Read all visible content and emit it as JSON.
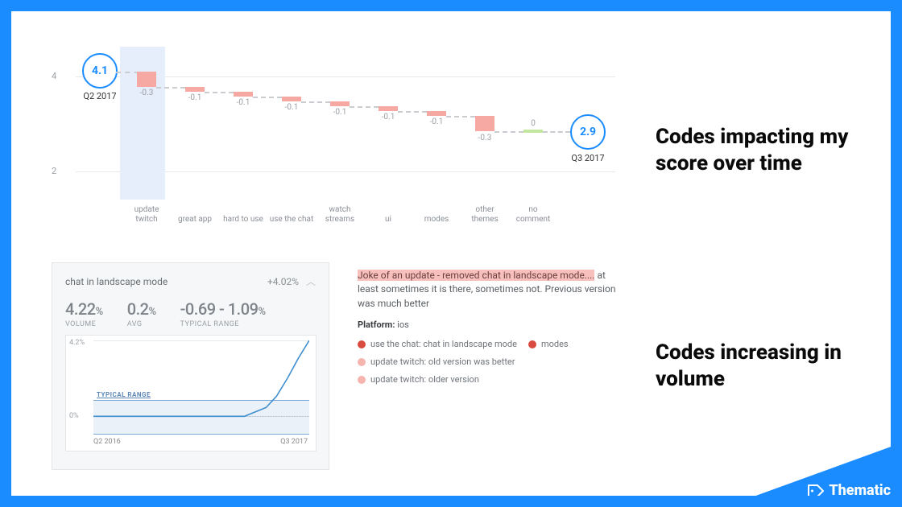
{
  "headings": {
    "top": "Codes impacting my score over time",
    "bottom": "Codes increasing in volume"
  },
  "chart_data": [
    {
      "type": "waterfall",
      "title": "",
      "xlabel": "",
      "ylabel": "",
      "ylim": [
        2,
        4.5
      ],
      "y_ticks": [
        2,
        4
      ],
      "start": {
        "label": "Q2 2017",
        "value": 4.1
      },
      "end": {
        "label": "Q3 2017",
        "value": 2.9
      },
      "categories": [
        "update twitch",
        "great app",
        "hard to use",
        "use the chat",
        "watch streams",
        "ui",
        "modes",
        "other themes",
        "no comment"
      ],
      "deltas": [
        -0.3,
        -0.1,
        -0.1,
        -0.1,
        -0.1,
        -0.1,
        -0.1,
        -0.3,
        0
      ],
      "delta_labels": [
        "-0.3",
        "-0.1",
        "-0.1",
        "-0.1",
        "-0.1",
        "-0.1",
        "-0.1",
        "-0.3",
        "0"
      ],
      "highlight_category": "update twitch"
    },
    {
      "type": "line",
      "title": "chat in landscape mode",
      "delta_pct_label": "+4.02%",
      "stats": {
        "volume": "4.22",
        "avg": "0.2",
        "typical_range": "-0.69 - 1.09"
      },
      "stat_labels": {
        "volume": "VOLUME",
        "avg": "AVG",
        "typical_range": "TYPICAL RANGE"
      },
      "xlabel_left": "Q2 2016",
      "xlabel_right": "Q3 2017",
      "ylabel_top": "4.2%",
      "ylabel_zero": "0%",
      "ylim": [
        -0.69,
        4.2
      ],
      "typical_range_band": [
        -0.69,
        1.09
      ],
      "typical_range_label": "TYPICAL RANGE",
      "x": [
        0,
        0.1,
        0.2,
        0.3,
        0.4,
        0.5,
        0.6,
        0.7,
        0.8,
        0.85,
        0.9,
        0.95,
        1.0
      ],
      "values": [
        0.2,
        0.2,
        0.2,
        0.2,
        0.2,
        0.2,
        0.2,
        0.2,
        0.6,
        1.2,
        2.2,
        3.2,
        4.2
      ]
    }
  ],
  "snippet": {
    "highlight": "Joke of an update - removed chat in landscape mode....",
    "rest": " at least sometimes it is there, sometimes not. Previous version was much better",
    "platform_label": "Platform:",
    "platform_value": "ios",
    "tags": [
      {
        "color": "red",
        "text": "use the chat: chat in landscape mode"
      },
      {
        "color": "red",
        "text": "modes"
      },
      {
        "color": "pink",
        "text": "update twitch: old version was better"
      },
      {
        "color": "pink",
        "text": "update twitch: older version"
      }
    ]
  },
  "brand": "Thematic"
}
